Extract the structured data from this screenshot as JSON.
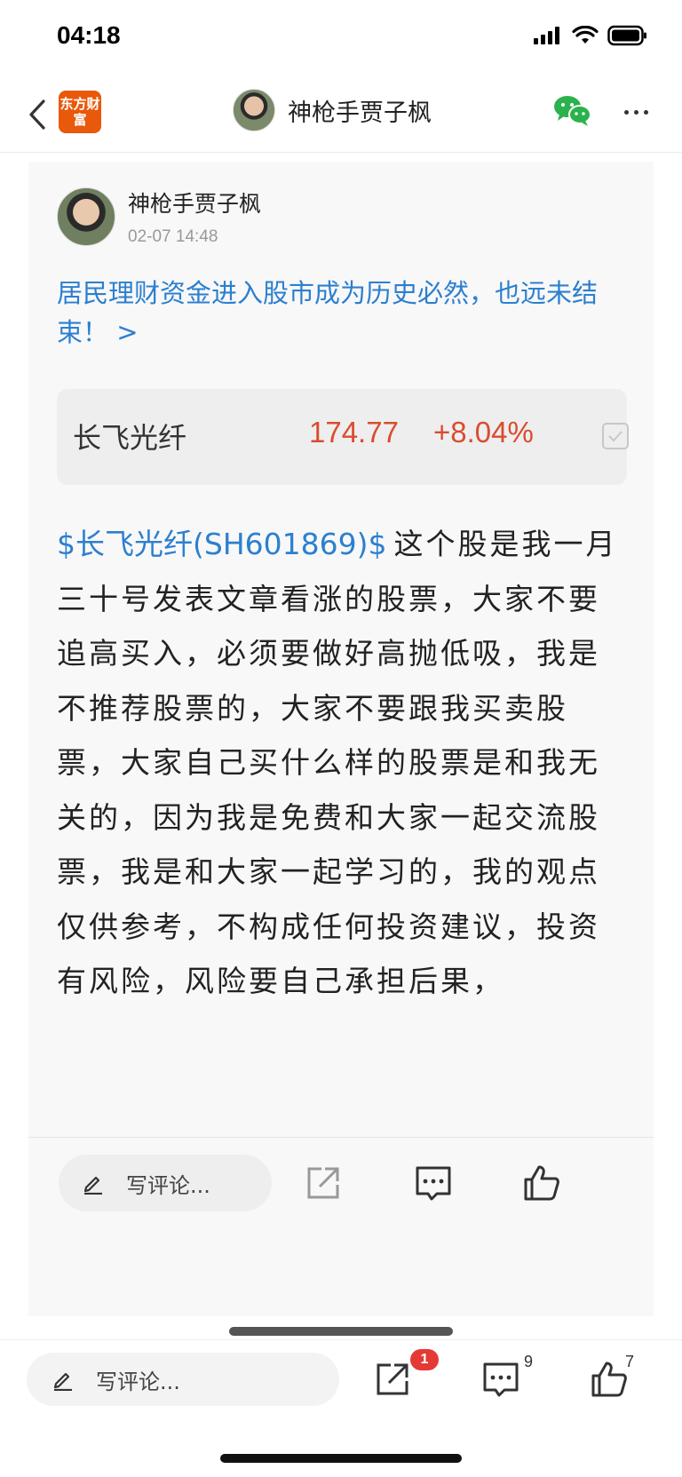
{
  "status_bar": {
    "time": "04:18"
  },
  "nav": {
    "app_logo": "东方财富",
    "title": "神枪手贾子枫",
    "icons": {
      "back": "chevron-left-icon",
      "share_wechat": "wechat-icon",
      "more": "more-horizontal-icon"
    }
  },
  "post": {
    "author": "神枪手贾子枫",
    "time": "02-07 14:48",
    "title": "居民理财资金进入股市成为历史必然，也远未结束！ >",
    "stock": {
      "name": "长飞光纤",
      "price": "174.77",
      "change": "+8.04%",
      "change_color": "#d94c2f"
    },
    "tag": "$长飞光纤(SH601869)$",
    "body": "这个股是我一月三十号发表文章看涨的股票，大家不要追高买入，必须要做好高抛低吸，我是不推荐股票的，大家不要跟我买卖股票，大家自己买什么样的股票是和我无关的，因为我是免费和大家一起交流股票，我是和大家一起学习的，我的观点仅供参考，不构成任何投资建议，投资有风险，风险要自己承担后果，",
    "actions": {
      "comment_placeholder": "写评论..."
    }
  },
  "bottom_bar": {
    "comment_placeholder": "写评论...",
    "share_badge": "1",
    "comment_count": "9",
    "like_count": "7"
  },
  "colors": {
    "link_blue": "#2c7fd0",
    "rise_red": "#d94c2f",
    "logo_orange": "#e8590c"
  }
}
